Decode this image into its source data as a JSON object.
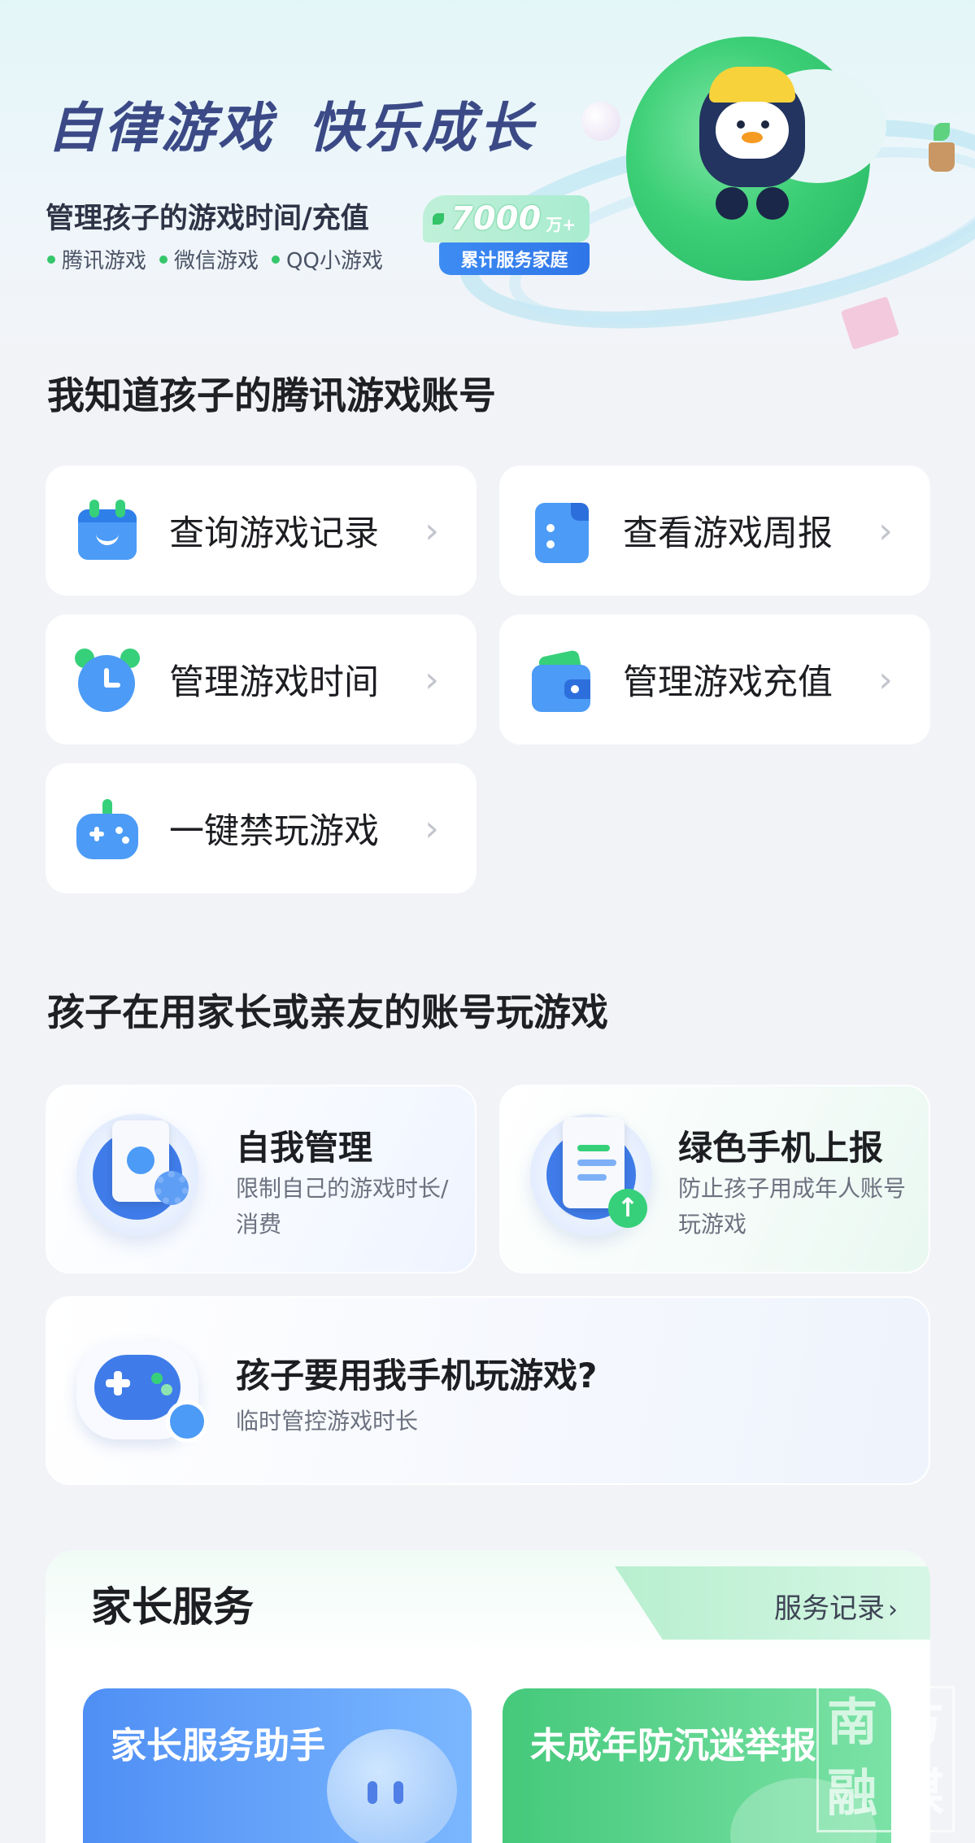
{
  "hero": {
    "title": "自律游戏 快乐成长",
    "subtitle": "管理孩子的游戏时间/充值",
    "tags": [
      "腾讯游戏",
      "微信游戏",
      "QQ小游戏"
    ],
    "badge": {
      "number": "7000",
      "unit": "万+",
      "label": "累计服务家庭"
    }
  },
  "section1": {
    "title": "我知道孩子的腾讯游戏账号",
    "items": [
      {
        "label": "查询游戏记录",
        "icon": "calendar-icon"
      },
      {
        "label": "查看游戏周报",
        "icon": "report-icon"
      },
      {
        "label": "管理游戏时间",
        "icon": "alarm-clock-icon"
      },
      {
        "label": "管理游戏充值",
        "icon": "wallet-icon"
      },
      {
        "label": "一键禁玩游戏",
        "icon": "gamepad-icon"
      }
    ],
    "chevron": "›"
  },
  "section2": {
    "title": "孩子在用家长或亲友的账号玩游戏",
    "cards": [
      {
        "title": "自我管理",
        "desc": "限制自己的游戏时长/消费"
      },
      {
        "title": "绿色手机上报",
        "desc": "防止孩子用成年人账号玩游戏"
      }
    ],
    "wide": {
      "title": "孩子要用我手机玩游戏?",
      "desc": "临时管控游戏时长"
    }
  },
  "service": {
    "title": "家长服务",
    "record": "服务记录",
    "record_chevron": "›",
    "cards": [
      {
        "label": "家长服务助手"
      },
      {
        "label": "未成年防沉迷举报"
      }
    ]
  },
  "watermark": [
    "南",
    "方",
    "融",
    "媒"
  ],
  "colors": {
    "accent_blue": "#4c9bf6",
    "accent_green": "#37d07a",
    "title_navy": "#3b4a86"
  }
}
